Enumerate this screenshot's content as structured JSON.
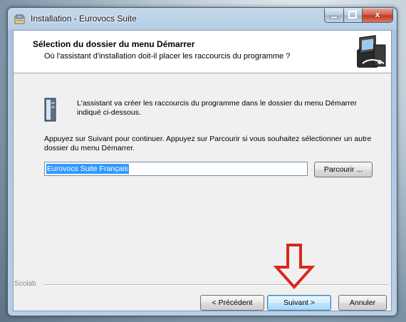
{
  "window": {
    "title": "Installation - Eurovocs Suite",
    "close_symbol": "x"
  },
  "header": {
    "title": "Sélection du dossier du menu Démarrer",
    "subtitle": "Où l'assistant d'installation doit-il placer les raccourcis du programme ?",
    "icon": "installer-computer-icon"
  },
  "body": {
    "icon": "start-menu-folder-icon",
    "info_text": "L'assistant va créer les raccourcis du programme dans le dossier du menu Démarrer indiqué ci-dessous.",
    "instructions": "Appuyez sur Suivant pour continuer. Appuyez sur Parcourir si vous souhaitez sélectionner un autre dossier du menu Démarrer.",
    "folder_value": "Eurovocs Suite Français",
    "browse_label": "Parcourir ..."
  },
  "footer": {
    "label": "Scolab",
    "back_label": "< Précédent",
    "next_label": "Suivant >",
    "cancel_label": "Annuler"
  },
  "annotation": {
    "icon": "red-down-arrow-icon",
    "color": "#d9281e"
  }
}
